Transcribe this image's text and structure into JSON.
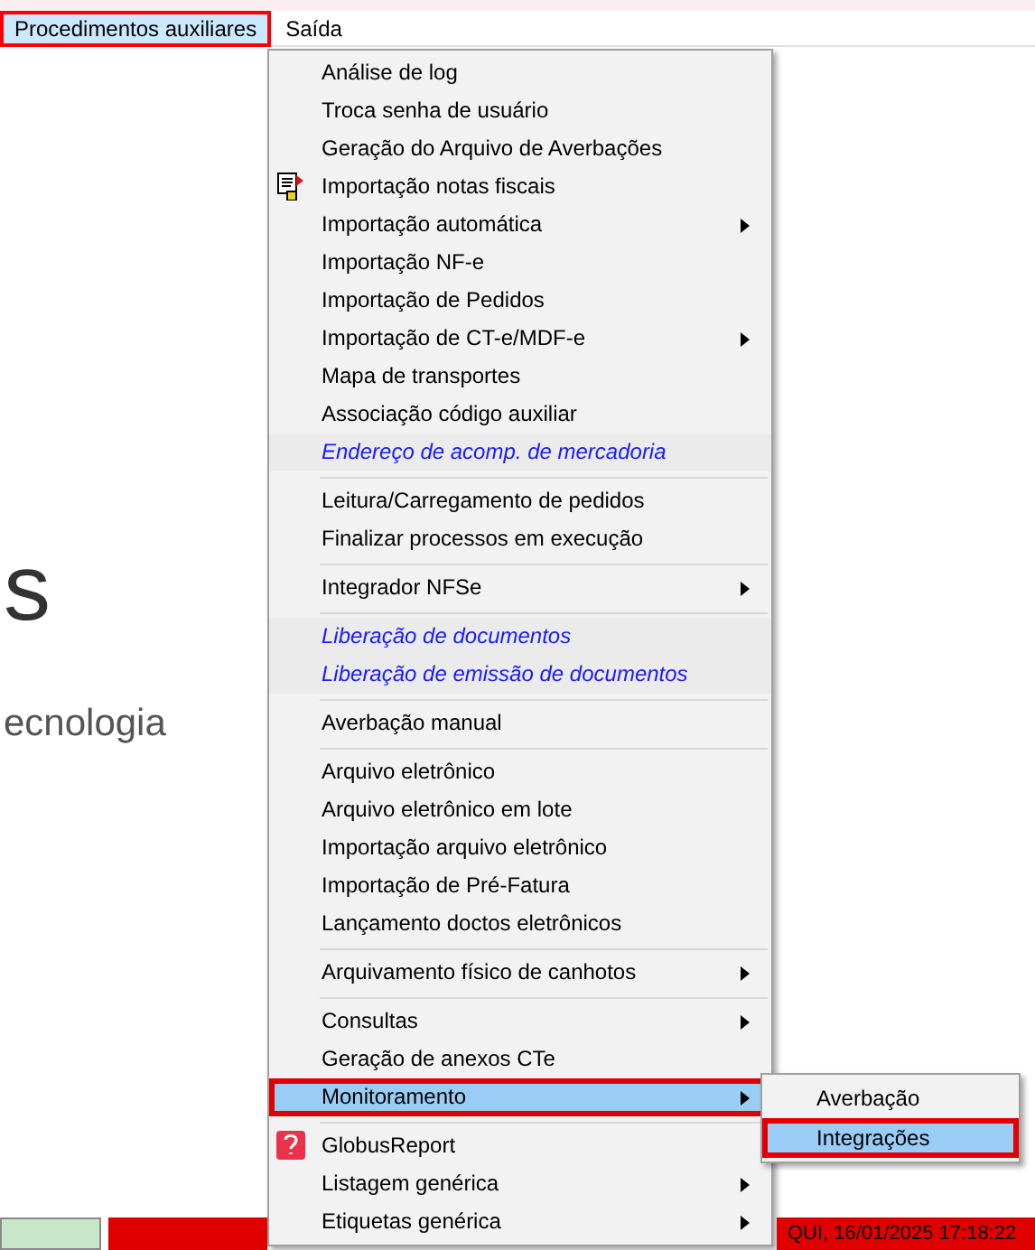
{
  "menu_bar": [
    {
      "label": "Procedimentos auxiliares",
      "selected": true,
      "highlighted": true
    },
    {
      "label": "Saída",
      "selected": false,
      "highlighted": false
    }
  ],
  "background": {
    "heading": "s",
    "tagline": "ecnologia"
  },
  "menu": [
    {
      "kind": "item",
      "label": "Análise de log"
    },
    {
      "kind": "item",
      "label": "Troca senha de usuário"
    },
    {
      "kind": "item",
      "label": "Geração do Arquivo de Averbações"
    },
    {
      "kind": "document",
      "label": "Importação notas fiscais"
    },
    {
      "kind": "item",
      "label": "Importação automática",
      "submenu": true
    },
    {
      "kind": "item",
      "label": "Importação NF-e"
    },
    {
      "kind": "item",
      "label": "Importação de Pedidos"
    },
    {
      "kind": "item",
      "label": "Importação de CT-e/MDF-e",
      "submenu": true
    },
    {
      "kind": "item",
      "label": "Mapa de transportes"
    },
    {
      "kind": "item",
      "label": "Associação código auxiliar"
    },
    {
      "kind": "link",
      "label": "Endereço de acomp. de mercadoria"
    },
    {
      "kind": "separator"
    },
    {
      "kind": "item",
      "label": "Leitura/Carregamento de pedidos"
    },
    {
      "kind": "item",
      "label": "Finalizar processos em execução"
    },
    {
      "kind": "separator"
    },
    {
      "kind": "item",
      "label": "Integrador NFSe",
      "submenu": true
    },
    {
      "kind": "separator"
    },
    {
      "kind": "link",
      "label": "Liberação de documentos"
    },
    {
      "kind": "link",
      "label": "Liberação de emissão de documentos"
    },
    {
      "kind": "separator"
    },
    {
      "kind": "item",
      "label": "Averbação manual"
    },
    {
      "kind": "separator"
    },
    {
      "kind": "item",
      "label": "Arquivo eletrônico"
    },
    {
      "kind": "item",
      "label": "Arquivo eletrônico em lote"
    },
    {
      "kind": "item",
      "label": "Importação arquivo eletrônico"
    },
    {
      "kind": "item",
      "label": "Importação de Pré-Fatura"
    },
    {
      "kind": "item",
      "label": "Lançamento doctos eletrônicos"
    },
    {
      "kind": "separator"
    },
    {
      "kind": "item",
      "label": "Arquivamento físico de canhotos",
      "submenu": true
    },
    {
      "kind": "separator"
    },
    {
      "kind": "item",
      "label": "Consultas",
      "submenu": true
    },
    {
      "kind": "item",
      "label": "Geração de anexos CTe"
    },
    {
      "kind": "item",
      "label": "Monitoramento",
      "submenu": true,
      "selected": true,
      "highlighted": true
    },
    {
      "kind": "separator"
    },
    {
      "kind": "report",
      "label": "GlobusReport"
    },
    {
      "kind": "item",
      "label": "Listagem genérica",
      "submenu": true
    },
    {
      "kind": "item",
      "label": "Etiquetas genérica",
      "submenu": true
    }
  ],
  "submenu": [
    {
      "label": "Averbação",
      "selected": false,
      "highlighted": false
    },
    {
      "label": "Integrações",
      "selected": true,
      "highlighted": true
    }
  ],
  "status_bar": {
    "clock": "QUI, 16/01/2025 17:18:22"
  }
}
